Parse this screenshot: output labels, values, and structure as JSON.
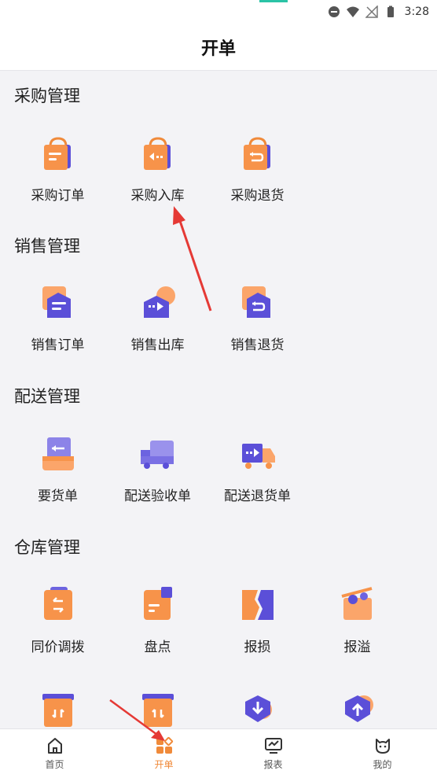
{
  "status_bar": {
    "time": "3:28"
  },
  "header": {
    "title": "开单"
  },
  "sections": [
    {
      "title": "采购管理",
      "items": [
        {
          "label": "采购订单",
          "icon": "purchase-order-icon"
        },
        {
          "label": "采购入库",
          "icon": "purchase-inbound-icon"
        },
        {
          "label": "采购退货",
          "icon": "purchase-return-icon"
        }
      ]
    },
    {
      "title": "销售管理",
      "items": [
        {
          "label": "销售订单",
          "icon": "sales-order-icon"
        },
        {
          "label": "销售出库",
          "icon": "sales-outbound-icon"
        },
        {
          "label": "销售退货",
          "icon": "sales-return-icon"
        }
      ]
    },
    {
      "title": "配送管理",
      "items": [
        {
          "label": "要货单",
          "icon": "requisition-icon"
        },
        {
          "label": "配送验收单",
          "icon": "delivery-truck-icon"
        },
        {
          "label": "配送退货单",
          "icon": "delivery-return-truck-icon"
        }
      ]
    },
    {
      "title": "仓库管理",
      "items": [
        {
          "label": "同价调拨",
          "icon": "transfer-icon"
        },
        {
          "label": "盘点",
          "icon": "stocktake-icon"
        },
        {
          "label": "报损",
          "icon": "damage-report-icon"
        },
        {
          "label": "报溢",
          "icon": "overflow-report-icon"
        }
      ]
    }
  ],
  "tabbar": [
    {
      "label": "首页",
      "icon": "home-icon",
      "active": false
    },
    {
      "label": "开单",
      "icon": "apps-grid-icon",
      "active": true
    },
    {
      "label": "报表",
      "icon": "report-monitor-icon",
      "active": false
    },
    {
      "label": "我的",
      "icon": "profile-cat-icon",
      "active": false
    }
  ],
  "colors": {
    "accent": "#f08a3a",
    "purple": "#5b4fd8",
    "orange_light": "#fba56a",
    "annotation": "#e53935"
  }
}
